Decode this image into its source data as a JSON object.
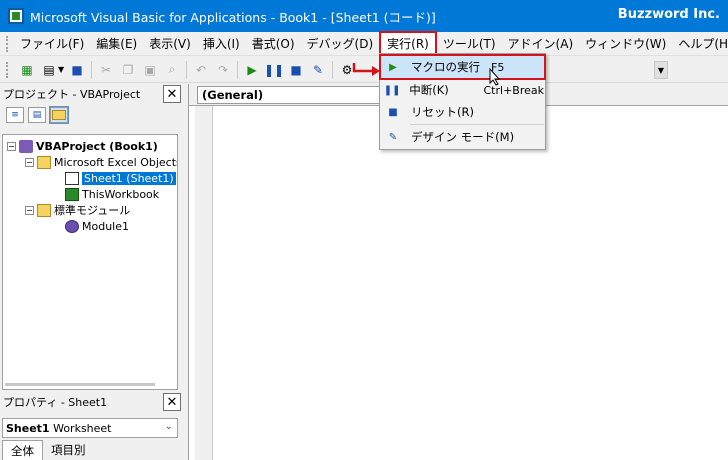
{
  "window": {
    "title": "Microsoft Visual Basic for Applications - Book1 - [Sheet1 (コード)]",
    "brand": "Buzzword Inc."
  },
  "menu": [
    {
      "label": "ファイル(F)"
    },
    {
      "label": "編集(E)"
    },
    {
      "label": "表示(V)"
    },
    {
      "label": "挿入(I)"
    },
    {
      "label": "書式(O)"
    },
    {
      "label": "デバッグ(D)"
    },
    {
      "label": "実行(R)",
      "open": true
    },
    {
      "label": "ツール(T)"
    },
    {
      "label": "アドイン(A)"
    },
    {
      "label": "ウィンドウ(W)"
    },
    {
      "label": "ヘルプ(H)"
    }
  ],
  "run_menu": [
    {
      "label": "マクロの実行",
      "shortcut": "F5",
      "icon": "play-icon",
      "highlighted": true
    },
    {
      "label": "中断(K)",
      "shortcut": "Ctrl+Break",
      "icon": "pause-icon"
    },
    {
      "label": "リセット(R)",
      "shortcut": "",
      "icon": "stop-icon"
    },
    {
      "label": "デザイン モード(M)",
      "shortcut": "",
      "icon": "design-mode-icon"
    }
  ],
  "project_panel": {
    "title": "プロジェクト - VBAProject",
    "tree": [
      {
        "label": "VBAProject (Book1)",
        "level": 0,
        "icon": "vba-project-icon",
        "expander": "−",
        "bold": true
      },
      {
        "label": "Microsoft Excel Objects",
        "level": 1,
        "icon": "folder-icon",
        "expander": "−"
      },
      {
        "label": "Sheet1 (Sheet1)",
        "level": 2,
        "icon": "worksheet-icon",
        "selected": true
      },
      {
        "label": "ThisWorkbook",
        "level": 2,
        "icon": "workbook-icon"
      },
      {
        "label": "標準モジュール",
        "level": 1,
        "icon": "folder-icon",
        "expander": "−"
      },
      {
        "label": "Module1",
        "level": 2,
        "icon": "module-icon"
      }
    ]
  },
  "properties_panel": {
    "title": "プロパティ - Sheet1",
    "object_name": "Sheet1",
    "object_type": "Worksheet",
    "tabs": [
      "全体",
      "項目別"
    ]
  },
  "code_window": {
    "object_combo": "(General)"
  }
}
